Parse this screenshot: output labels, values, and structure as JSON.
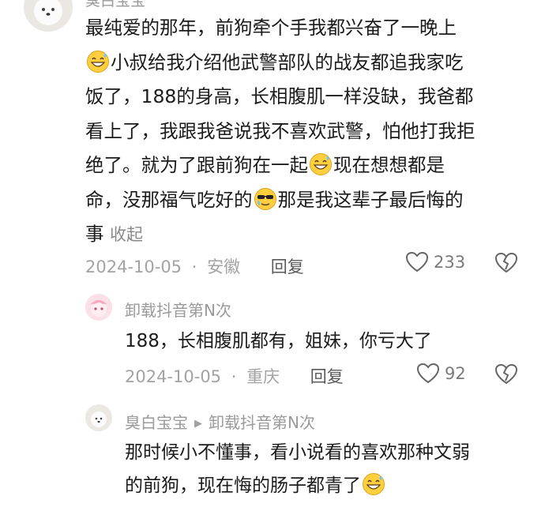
{
  "comment": {
    "author": "臭白宝宝",
    "lines": [
      "最纯爱的那年，前狗牵个手我都兴奋了一晚上",
      "小叔给我介绍他武警部队的战友都追我家吃",
      "饭了，188的身高，长相腹肌一样没缺，我爸都",
      "看上了，我跟我爸说我不喜欢武警，怕他打我拒",
      "绝了。就为了跟前狗在一起",
      "现在想想都是",
      "命，没那福气吃好的",
      "那是我这辈子最后悔的",
      "事"
    ],
    "collapse_label": "收起",
    "date": "2024-10-05",
    "location": "安徽",
    "reply_label": "回复",
    "like_count": "233"
  },
  "reply1": {
    "author": "卸载抖音第N次",
    "text": "188，长相腹肌都有，姐妹，你亏大了",
    "date": "2024-10-05",
    "location": "重庆",
    "reply_label": "回复",
    "like_count": "92"
  },
  "reply2": {
    "author": "臭白宝宝",
    "reply_to": "卸载抖音第N次",
    "line1": "那时候小不懂事，看小说看的喜欢那种文弱",
    "line2": "的前狗，现在悔的肠子都青了"
  },
  "separator": "·",
  "icons": {
    "emoji_grin_sweat": "grinning-sweat-emoji",
    "emoji_sunglasses_tear": "sunglasses-tear-emoji",
    "heart": "heart-icon",
    "dislike": "broken-heart-icon",
    "arrow": "triangle-right-icon"
  }
}
